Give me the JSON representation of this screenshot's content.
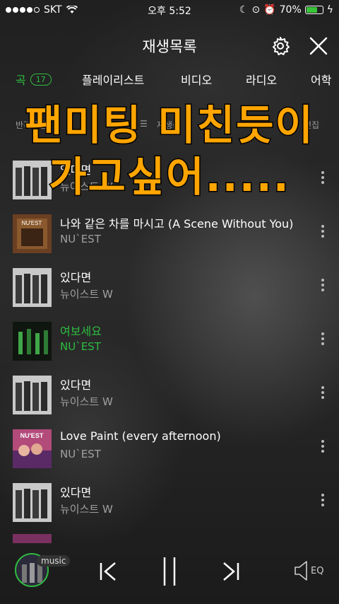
{
  "status_bar": {
    "carrier": "SKT",
    "time": "오후 5:52",
    "battery": "70%"
  },
  "header": {
    "title": "재생목록"
  },
  "tabs": [
    {
      "label": "곡",
      "count": "17"
    },
    {
      "label": "플레이리스트"
    },
    {
      "label": "비디오"
    },
    {
      "label": "라디오"
    },
    {
      "label": "어학"
    }
  ],
  "toolbar": {
    "left_label": "반복재생",
    "sort_label": "재생순",
    "right_label": "편집"
  },
  "caption": {
    "line1": "팬미팅 미친듯이",
    "line2": "가고싶어....."
  },
  "songs": [
    {
      "title": "있다면",
      "artist": "뉴이스트 W"
    },
    {
      "title": "나와 같은 차를 마시고 (A Scene Without You)",
      "artist": "NU`EST"
    },
    {
      "title": "있다면",
      "artist": "뉴이스트 W"
    },
    {
      "title": "여보세요",
      "artist": "NU`EST"
    },
    {
      "title": "있다면",
      "artist": "뉴이스트 W"
    },
    {
      "title": "Love Paint (every afternoon)",
      "artist": "NU`EST"
    },
    {
      "title": "있다면",
      "artist": "뉴이스트 W"
    }
  ],
  "player": {
    "badge": "music",
    "eq_label": "EQ"
  },
  "colors": {
    "accent": "#2dbd40",
    "caption": "#ffa500"
  }
}
